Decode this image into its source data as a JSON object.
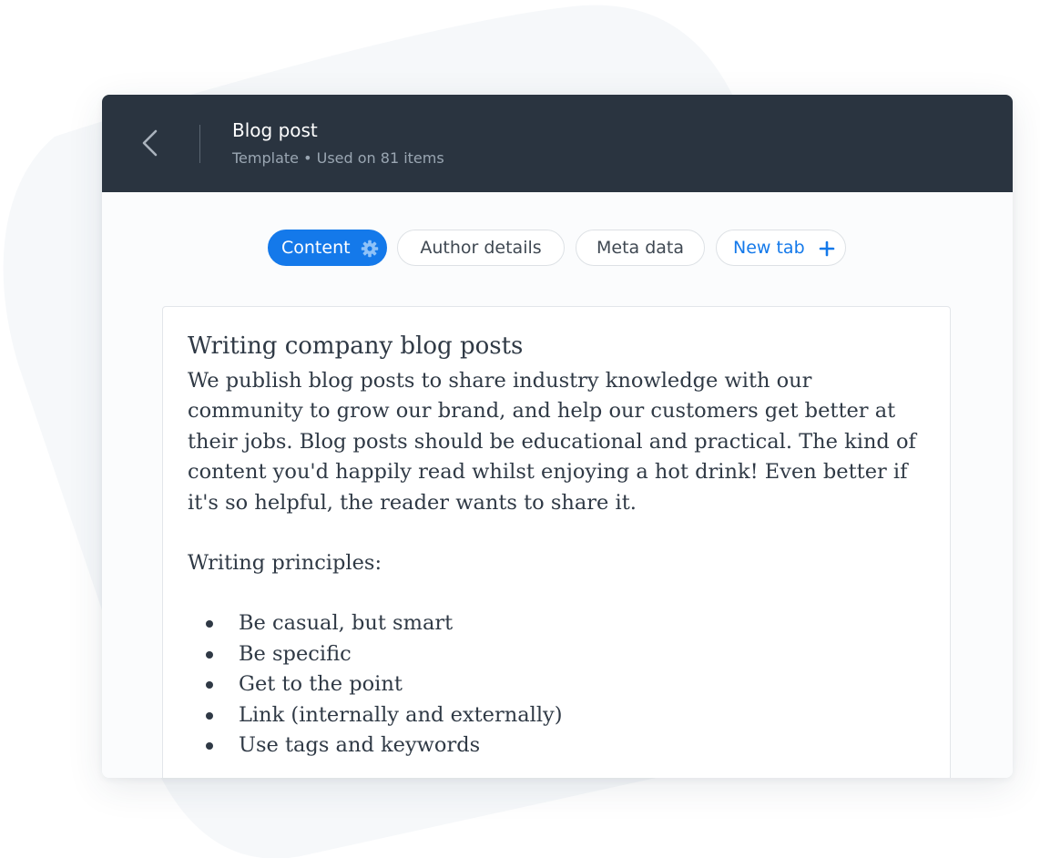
{
  "colors": {
    "header_bg": "#2a3440",
    "accent": "#1479ea",
    "backdrop": "#f6f8fa"
  },
  "header": {
    "back_icon": "chevron-left-icon",
    "title": "Blog post",
    "subtitle": "Template • Used on 81 items"
  },
  "tabs": [
    {
      "label": "Content",
      "active": true,
      "icon": "gear-icon"
    },
    {
      "label": "Author details",
      "active": false
    },
    {
      "label": "Meta data",
      "active": false
    },
    {
      "label": "New tab",
      "active": false,
      "icon": "plus-icon"
    }
  ],
  "document": {
    "title": "Writing company blog posts",
    "intro": "We publish blog posts to share industry knowledge with our community to grow our brand, and help our customers get better at their jobs. Blog posts should be educational and practical. The kind of content you'd happily read whilst enjoying a hot drink! Even better if it's so helpful, the reader wants to share it.",
    "principles_heading": "Writing principles:",
    "principles": [
      "Be casual, but smart",
      "Be specific",
      "Get to the point",
      "Link (internally and externally)",
      "Use tags and keywords"
    ]
  }
}
